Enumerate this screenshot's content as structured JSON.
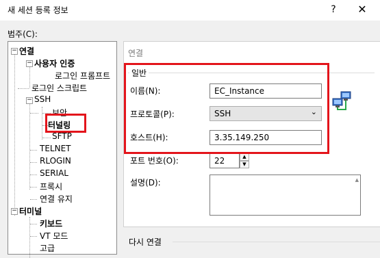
{
  "window": {
    "title": "새 세션 등록 정보",
    "help_label": "?",
    "close_label": "✕"
  },
  "category_label": "범주(C):",
  "tree": [
    {
      "name": "tree-item-connection",
      "label": "연결",
      "bold": true,
      "toggle": "minus"
    },
    {
      "name": "tree-item-user-auth",
      "label": "사용자 인증",
      "bold": true,
      "toggle": "minus"
    },
    {
      "name": "tree-item-login-prompt",
      "label": "로그인 프롬프트",
      "bold": false
    },
    {
      "name": "tree-item-login-script",
      "label": "로그인 스크립트",
      "bold": false
    },
    {
      "name": "tree-item-ssh",
      "label": "SSH",
      "bold": false,
      "toggle": "minus"
    },
    {
      "name": "tree-item-security",
      "label": "보안",
      "bold": false
    },
    {
      "name": "tree-item-tunneling",
      "label": "터널링",
      "bold": true
    },
    {
      "name": "tree-item-sftp",
      "label": "SFTP",
      "bold": false
    },
    {
      "name": "tree-item-telnet",
      "label": "TELNET",
      "bold": false
    },
    {
      "name": "tree-item-rlogin",
      "label": "RLOGIN",
      "bold": false
    },
    {
      "name": "tree-item-serial",
      "label": "SERIAL",
      "bold": false
    },
    {
      "name": "tree-item-proxy",
      "label": "프록시",
      "bold": false
    },
    {
      "name": "tree-item-keepalive",
      "label": "연결 유지",
      "bold": false
    },
    {
      "name": "tree-item-terminal",
      "label": "터미널",
      "bold": true,
      "toggle": "minus"
    },
    {
      "name": "tree-item-keyboard",
      "label": "키보드",
      "bold": true
    },
    {
      "name": "tree-item-vt-mode",
      "label": "VT 모드",
      "bold": false
    },
    {
      "name": "tree-item-advanced",
      "label": "고급",
      "bold": false
    }
  ],
  "panel": {
    "header": "연결",
    "general_label": "일반",
    "name": {
      "label": "이름(N):",
      "value": "EC_Instance"
    },
    "protocol": {
      "label": "프로토콜(P):",
      "value": "SSH"
    },
    "host": {
      "label": "호스트(H):",
      "value": "3.35.149.250"
    },
    "port": {
      "label": "포트 번호(O):",
      "value": "22"
    },
    "description": {
      "label": "설명(D):",
      "value": ""
    },
    "reconnect_label": "다시 연결"
  },
  "colors": {
    "highlight": "#e3141b"
  }
}
